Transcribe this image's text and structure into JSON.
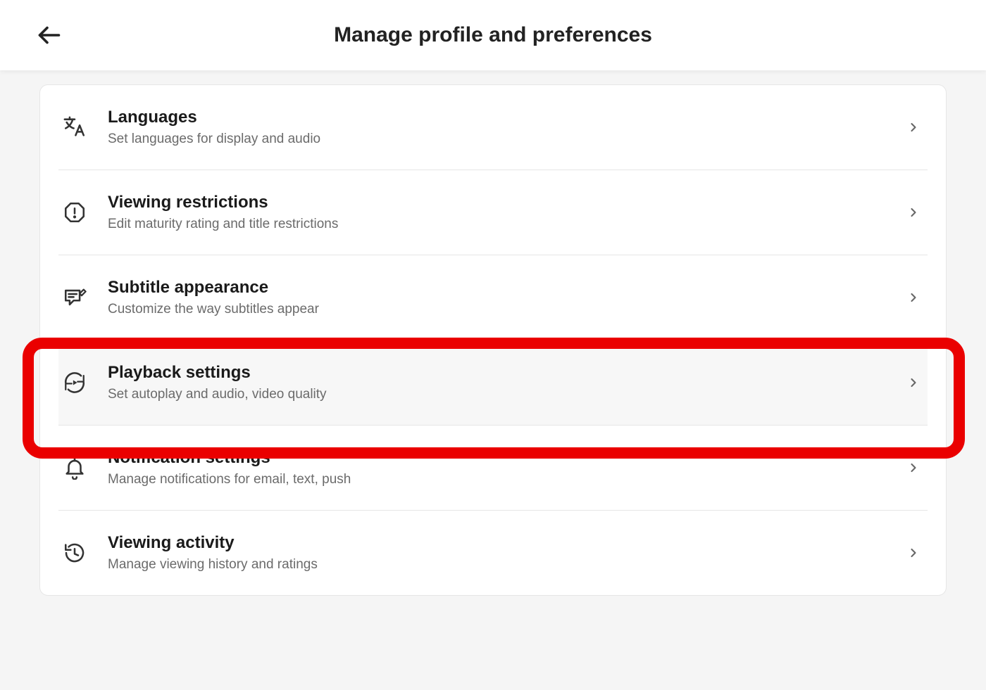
{
  "header": {
    "title": "Manage profile and preferences"
  },
  "rows": [
    {
      "title": "Languages",
      "sub": "Set languages for display and audio"
    },
    {
      "title": "Viewing restrictions",
      "sub": "Edit maturity rating and title restrictions"
    },
    {
      "title": "Subtitle appearance",
      "sub": "Customize the way subtitles appear"
    },
    {
      "title": "Playback settings",
      "sub": "Set autoplay and audio, video quality"
    },
    {
      "title": "Notification settings",
      "sub": "Manage notifications for email, text, push"
    },
    {
      "title": "Viewing activity",
      "sub": "Manage viewing history and ratings"
    }
  ]
}
